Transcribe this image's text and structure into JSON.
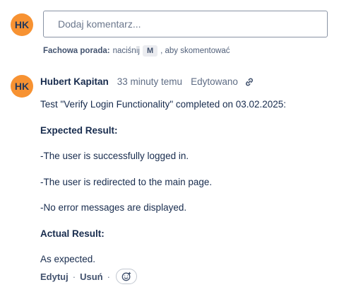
{
  "composer": {
    "avatar_initials": "HK",
    "placeholder": "Dodaj komentarz...",
    "tip_label": "Fachowa porada:",
    "tip_press": "naciśnij",
    "tip_key": "M",
    "tip_suffix": ", aby skomentować"
  },
  "comment": {
    "avatar_initials": "HK",
    "author": "Hubert Kapitan",
    "time": "33 minuty temu",
    "edited": "Edytowano",
    "lines": [
      "Test \"Verify Login Functionality\" completed on 03.02.2025:",
      "Expected Result:",
      "-The user is successfully logged in.",
      "-The user is redirected to the main page.",
      "-No error messages are displayed.",
      "Actual Result:",
      "As expected."
    ],
    "actions": {
      "edit": "Edytuj",
      "delete": "Usuń",
      "separator": "·"
    }
  },
  "colors": {
    "avatar_bg": "#f79232",
    "text_primary": "#172b4d",
    "text_secondary": "#5e6c84"
  },
  "icons": {
    "permalink": "link-icon",
    "reaction": "emoji-add-icon"
  }
}
